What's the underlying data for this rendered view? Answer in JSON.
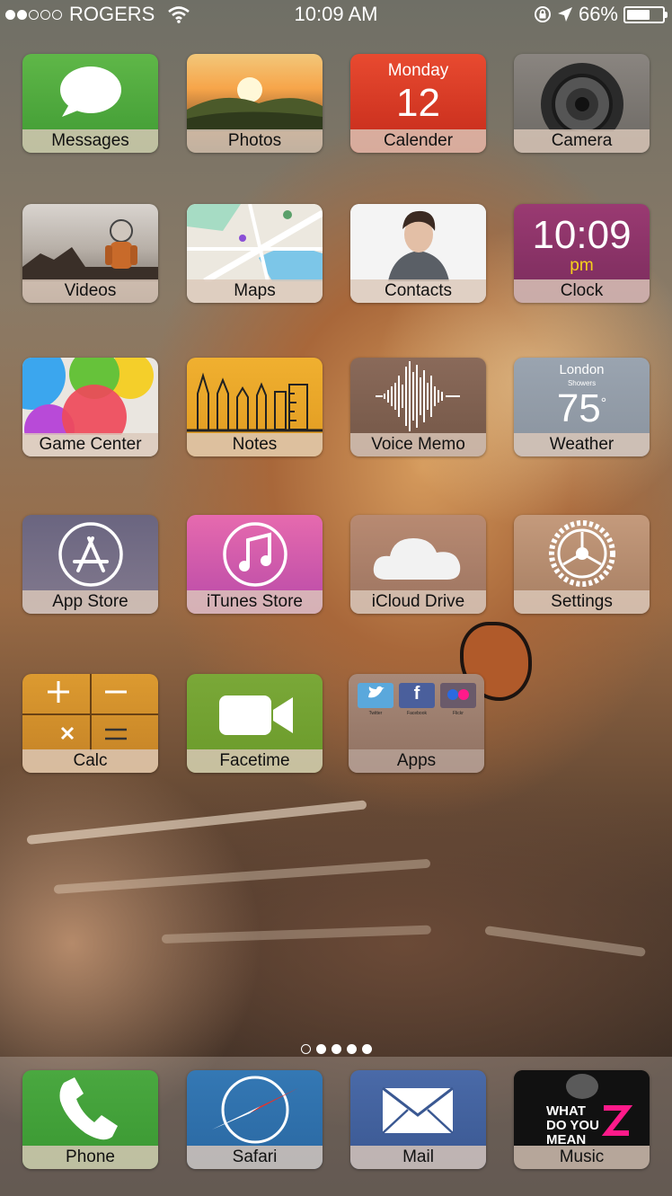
{
  "status": {
    "carrier": "ROGERS",
    "time": "10:09 AM",
    "battery": "66%",
    "battery_level": 0.66,
    "signal_bars": 2
  },
  "pager": {
    "pages": 5,
    "current_index": 0
  },
  "apps": {
    "messages": {
      "label": "Messages"
    },
    "photos": {
      "label": "Photos"
    },
    "calendar": {
      "label": "Calender",
      "day": "Monday",
      "date": "12"
    },
    "camera": {
      "label": "Camera"
    },
    "videos": {
      "label": "Videos"
    },
    "maps": {
      "label": "Maps"
    },
    "contacts": {
      "label": "Contacts"
    },
    "clock": {
      "label": "Clock",
      "time": "10:09",
      "ampm": "pm"
    },
    "game_center": {
      "label": "Game Center"
    },
    "notes": {
      "label": "Notes"
    },
    "voice_memo": {
      "label": "Voice Memo"
    },
    "weather": {
      "label": "Weather",
      "city": "London",
      "condition": "Showers",
      "temp": "75"
    },
    "app_store": {
      "label": "App Store"
    },
    "itunes_store": {
      "label": "iTunes Store"
    },
    "icloud_drive": {
      "label": "iCloud Drive"
    },
    "settings": {
      "label": "Settings"
    },
    "calc": {
      "label": "Calc"
    },
    "facetime": {
      "label": "Facetime"
    },
    "apps_folder": {
      "label": "Apps",
      "items": [
        "Twitter",
        "Facebook",
        "Flickr"
      ]
    }
  },
  "dock": {
    "phone": {
      "label": "Phone"
    },
    "safari": {
      "label": "Safari"
    },
    "mail": {
      "label": "Mail"
    },
    "music": {
      "label": "Music",
      "art_text": "WHAT DO YOU MEAN"
    }
  },
  "colors": {
    "messages": "#4aa33a",
    "facetime": "#6a9a2a",
    "itunes": "#d24aa8",
    "clock": "#8a3a6a",
    "mail": "#3c5a9a",
    "safari": "#2f6ea8"
  }
}
